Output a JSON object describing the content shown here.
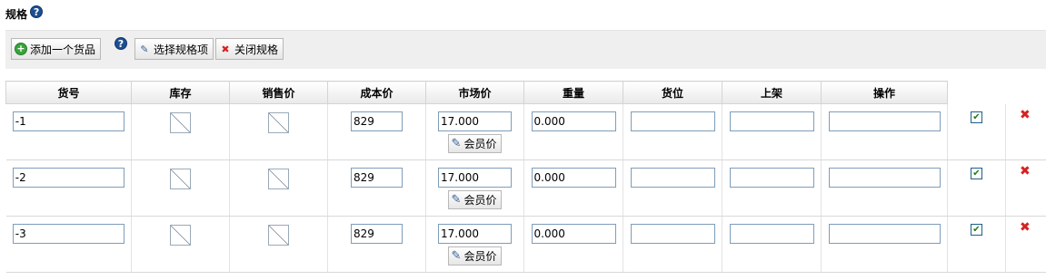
{
  "section": {
    "title": "规格",
    "help_glyph": "?"
  },
  "toolbar": {
    "add_label": "添加一个货品",
    "select_label": "选择规格项",
    "close_label": "关闭规格",
    "help_glyph": "?"
  },
  "table": {
    "headers": [
      "货号",
      "库存",
      "销售价",
      "成本价",
      "市场价",
      "重量",
      "货位",
      "上架",
      "操作"
    ],
    "rows": [
      {
        "sku": "-1",
        "cost": "829",
        "market": "17.000",
        "weight": "0.000",
        "location": "",
        "shelf": "",
        "action": "",
        "member_label": "会员价",
        "enabled": true
      },
      {
        "sku": "-2",
        "cost": "829",
        "market": "17.000",
        "weight": "0.000",
        "location": "",
        "shelf": "",
        "action": "",
        "member_label": "会员价",
        "enabled": true
      },
      {
        "sku": "-3",
        "cost": "829",
        "market": "17.000",
        "weight": "0.000",
        "location": "",
        "shelf": "",
        "action": "",
        "member_label": "会员价",
        "enabled": true
      }
    ]
  },
  "icons": {
    "help": "help-icon",
    "add": "add-circle-icon",
    "edit": "pencil-icon",
    "close": "close-x-icon",
    "checkbox": "checkbox-checked-icon",
    "delete": "delete-x-icon",
    "image": "image-placeholder-icon"
  },
  "colors": {
    "accent_blue": "#1d4f91",
    "delete_red": "#d42323",
    "add_green": "#37a53a",
    "toolbar_bg": "#efefef"
  }
}
